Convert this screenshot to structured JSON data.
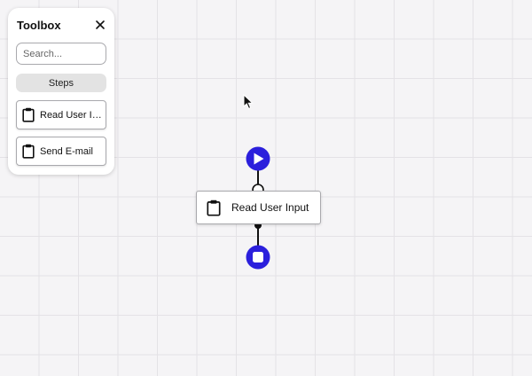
{
  "toolbox": {
    "title": "Toolbox",
    "close_icon": "close-icon",
    "search_placeholder": "Search...",
    "category_label": "Steps",
    "items": [
      {
        "label": "Read User Input",
        "icon": "clipboard-icon"
      },
      {
        "label": "Send E-mail",
        "icon": "clipboard-icon"
      }
    ]
  },
  "flow": {
    "start_icon": "play-icon",
    "end_icon": "stop-icon",
    "node": {
      "label": "Read User Input",
      "icon": "clipboard-icon"
    }
  },
  "colors": {
    "accent": "#2b1fdc",
    "background": "#f5f4f6",
    "grid": "#e4e2e6"
  }
}
